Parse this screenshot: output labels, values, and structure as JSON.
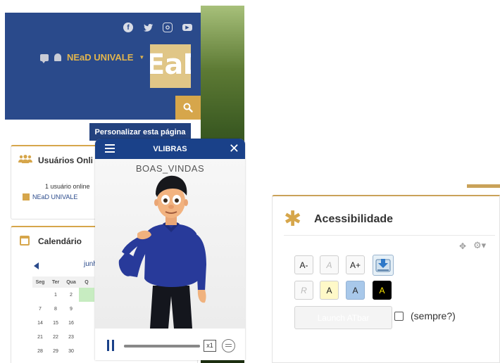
{
  "header": {
    "social_icons": [
      "facebook-icon",
      "twitter-icon",
      "instagram-icon",
      "youtube-icon"
    ],
    "user_name": "NEaD UNIVALE",
    "logo_text": "EaD",
    "personalize_label": "Personalizar esta página"
  },
  "users_block": {
    "title": "Usuários Onli",
    "online_count": "1 usuário online",
    "user": "NEaD UNIVALE"
  },
  "calendar": {
    "title": "Calendário",
    "month": "junh",
    "weekdays": [
      "Seg",
      "Ter",
      "Qua",
      "Q"
    ],
    "weeks": [
      [
        "",
        "1",
        "2",
        ""
      ],
      [
        "7",
        "8",
        "9",
        ""
      ],
      [
        "14",
        "15",
        "16",
        ""
      ],
      [
        "21",
        "22",
        "23",
        ""
      ],
      [
        "28",
        "29",
        "30",
        ""
      ]
    ]
  },
  "vlibras": {
    "title": "VLIBRAS",
    "gloss": "BOAS_VINDAS",
    "speed": "x1",
    "progress": 1.0
  },
  "accessibility": {
    "title": "Acessibilidade",
    "btn_decrease": "A-",
    "btn_reset": "A",
    "btn_increase": "A+",
    "btn_color_reset": "R",
    "btn_color1": "A",
    "btn_color2": "A",
    "btn_color3": "A",
    "launch_label": "Launch ATbar",
    "always_label": "(sempre?)",
    "colors": {
      "accent": "#d6a64b",
      "scheme1": "#fff9c8",
      "scheme2": "#a8c8ea",
      "scheme3_bg": "#000000",
      "scheme3_fg": "#ffe800"
    }
  },
  "colors": {
    "header_blue": "#2a4a8b",
    "vlibras_blue": "#1a4189",
    "gold": "#d6a64b"
  }
}
